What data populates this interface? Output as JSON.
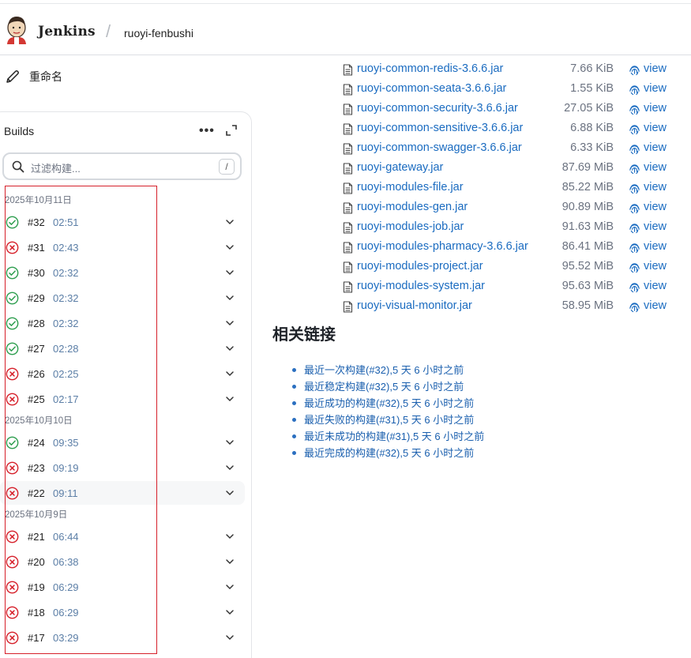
{
  "header": {
    "brand": "Jenkins",
    "breadcrumb": "ruoyi-fenbushi"
  },
  "sidebar": {
    "rename_label": "重命名"
  },
  "builds": {
    "title": "Builds",
    "more_icon": "ellipsis-icon",
    "expand_icon": "expand-icon",
    "search_placeholder": "过滤构建...",
    "search_shortcut": "/",
    "groups": [
      {
        "date": "2025年10月11日",
        "items": [
          {
            "number": "#32",
            "time": "02:51",
            "status": "success"
          },
          {
            "number": "#31",
            "time": "02:43",
            "status": "failed"
          },
          {
            "number": "#30",
            "time": "02:32",
            "status": "success"
          },
          {
            "number": "#29",
            "time": "02:32",
            "status": "success"
          },
          {
            "number": "#28",
            "time": "02:32",
            "status": "success"
          },
          {
            "number": "#27",
            "time": "02:28",
            "status": "success"
          },
          {
            "number": "#26",
            "time": "02:25",
            "status": "failed"
          },
          {
            "number": "#25",
            "time": "02:17",
            "status": "failed"
          }
        ]
      },
      {
        "date": "2025年10月10日",
        "items": [
          {
            "number": "#24",
            "time": "09:35",
            "status": "success"
          },
          {
            "number": "#23",
            "time": "09:19",
            "status": "failed"
          },
          {
            "number": "#22",
            "time": "09:11",
            "status": "failed"
          }
        ]
      },
      {
        "date": "2025年10月9日",
        "items": [
          {
            "number": "#21",
            "time": "06:44",
            "status": "failed"
          },
          {
            "number": "#20",
            "time": "06:38",
            "status": "failed"
          },
          {
            "number": "#19",
            "time": "06:29",
            "status": "failed"
          },
          {
            "number": "#18",
            "time": "06:29",
            "status": "failed"
          },
          {
            "number": "#17",
            "time": "03:29",
            "status": "failed"
          }
        ]
      }
    ]
  },
  "artifacts": {
    "view_label": "view",
    "items": [
      {
        "name": "ruoyi-common-redis-3.6.6.jar",
        "size": "7.66 KiB"
      },
      {
        "name": "ruoyi-common-seata-3.6.6.jar",
        "size": "1.55 KiB"
      },
      {
        "name": "ruoyi-common-security-3.6.6.jar",
        "size": "27.05 KiB"
      },
      {
        "name": "ruoyi-common-sensitive-3.6.6.jar",
        "size": "6.88 KiB"
      },
      {
        "name": "ruoyi-common-swagger-3.6.6.jar",
        "size": "6.33 KiB"
      },
      {
        "name": "ruoyi-gateway.jar",
        "size": "87.69 MiB"
      },
      {
        "name": "ruoyi-modules-file.jar",
        "size": "85.22 MiB"
      },
      {
        "name": "ruoyi-modules-gen.jar",
        "size": "90.89 MiB"
      },
      {
        "name": "ruoyi-modules-job.jar",
        "size": "91.63 MiB"
      },
      {
        "name": "ruoyi-modules-pharmacy-3.6.6.jar",
        "size": "86.41 MiB"
      },
      {
        "name": "ruoyi-modules-project.jar",
        "size": "95.52 MiB"
      },
      {
        "name": "ruoyi-modules-system.jar",
        "size": "95.63 MiB"
      },
      {
        "name": "ruoyi-visual-monitor.jar",
        "size": "58.95 MiB"
      }
    ]
  },
  "related": {
    "title": "相关链接",
    "links": [
      "最近一次构建(#32),5 天 6 小时之前",
      "最近稳定构建(#32),5 天 6 小时之前",
      "最近成功的构建(#32),5 天 6 小时之前",
      "最近失败的构建(#31),5 天 6 小时之前",
      "最近未成功的构建(#31),5 天 6 小时之前",
      "最近完成的构建(#32),5 天 6 小时之前"
    ]
  },
  "colors": {
    "success": "#2e9e4f",
    "failed": "#d6202a",
    "link": "#1a6bc0",
    "highlight": "#d6202a"
  }
}
